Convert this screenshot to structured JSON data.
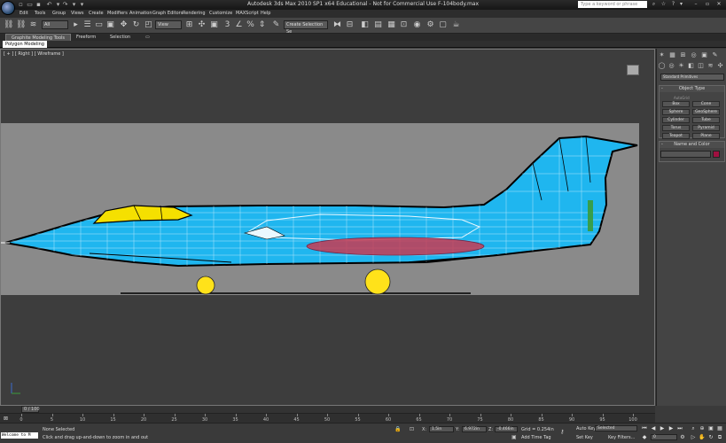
{
  "window": {
    "title": "Autodesk 3ds Max  2010 SP1 x64   Educational - Not for Commercial Use    F-104body.max",
    "search_placeholder": "Type a keyword or phrase"
  },
  "menu": [
    "Edit",
    "Tools",
    "Group",
    "Views",
    "Create",
    "Modifiers",
    "Animation",
    "Graph Editors",
    "Rendering",
    "Customize",
    "MAXScript",
    "Help"
  ],
  "toolbar": {
    "selection_filter": "All",
    "reference_coord": "View",
    "named_selection": "Create Selection Se"
  },
  "ribbon": {
    "tabs": [
      "Graphite Modeling Tools",
      "Freeform",
      "Selection"
    ],
    "active_tab": "Graphite Modeling Tools",
    "sub_tab": "Polygon Modeling"
  },
  "viewport": {
    "label": "[ + ] [ Right ] [ Wireframe ]"
  },
  "command_panel": {
    "category": "Standard Primitives",
    "object_type_title": "Object Type",
    "autogrid": "AutoGrid",
    "buttons": [
      "Box",
      "Cone",
      "Sphere",
      "GeoSphere",
      "Cylinder",
      "Tube",
      "Torus",
      "Pyramid",
      "Teapot",
      "Plane"
    ],
    "name_color_title": "Name and Color",
    "object_color": "#a01040"
  },
  "timeline": {
    "slider_text": "0 / 100",
    "ticks": [
      "0",
      "5",
      "10",
      "15",
      "20",
      "25",
      "30",
      "35",
      "40",
      "45",
      "50",
      "55",
      "60",
      "65",
      "70",
      "75",
      "80",
      "85",
      "90",
      "95",
      "100"
    ]
  },
  "status": {
    "listener": "Welcome to M",
    "selection": "None Selected",
    "prompt": "Click and drag up-and-down to zoom in and out",
    "x_label": "X:",
    "x_value": "1.5in",
    "y_label": "Y:",
    "y_value": "6.972in",
    "z_label": "Z:",
    "z_value": "-0.466in",
    "grid": "Grid = 0.254in",
    "add_time_tag": "Add Time Tag",
    "auto_key": "Auto Key",
    "auto_key_value": "Selected",
    "set_key": "Set Key",
    "key_filters": "Key Filters...",
    "frame": "0"
  },
  "colors": {
    "fuselage": "#1fb6ef",
    "canopy": "#f5e000",
    "wheels": "#ffe21a",
    "tank": "#c83a52"
  }
}
